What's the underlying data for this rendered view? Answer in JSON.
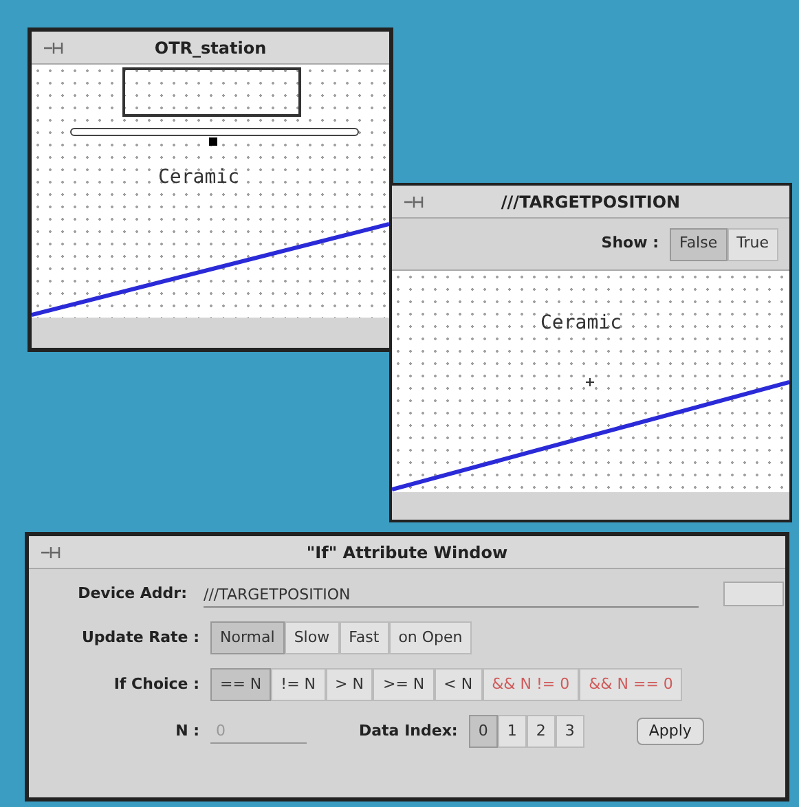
{
  "station_window": {
    "title": "OTR_station",
    "label": "Ceramic"
  },
  "target_window": {
    "title": "///TARGETPOSITION",
    "show_label": "Show :",
    "show_options": [
      {
        "label": "False",
        "selected": true
      },
      {
        "label": "True",
        "selected": false
      }
    ],
    "label": "Ceramic"
  },
  "attribute_window": {
    "title": "\"If\" Attribute Window",
    "device_addr": {
      "label": "Device Addr:",
      "value": "///TARGETPOSITION"
    },
    "update_rate": {
      "label": "Update Rate :",
      "options": [
        {
          "label": "Normal",
          "selected": true
        },
        {
          "label": "Slow",
          "selected": false
        },
        {
          "label": "Fast",
          "selected": false
        },
        {
          "label": "on Open",
          "selected": false
        }
      ]
    },
    "if_choice": {
      "label": "If Choice :",
      "options": [
        {
          "label": "== N",
          "selected": true,
          "color": "#333333"
        },
        {
          "label": "!= N",
          "selected": false,
          "color": "#333333"
        },
        {
          "label": "> N",
          "selected": false,
          "color": "#333333"
        },
        {
          "label": ">= N",
          "selected": false,
          "color": "#333333"
        },
        {
          "label": "< N",
          "selected": false,
          "color": "#333333"
        },
        {
          "label": "&& N != 0",
          "selected": false,
          "color": "#d05a5a"
        },
        {
          "label": "&& N == 0",
          "selected": false,
          "color": "#d05a5a"
        }
      ]
    },
    "n": {
      "label": "N :",
      "value": "0"
    },
    "data_index": {
      "label": "Data Index:",
      "options": [
        {
          "label": "0",
          "selected": true
        },
        {
          "label": "1",
          "selected": false
        },
        {
          "label": "2",
          "selected": false
        },
        {
          "label": "3",
          "selected": false
        }
      ]
    },
    "apply": "Apply"
  }
}
